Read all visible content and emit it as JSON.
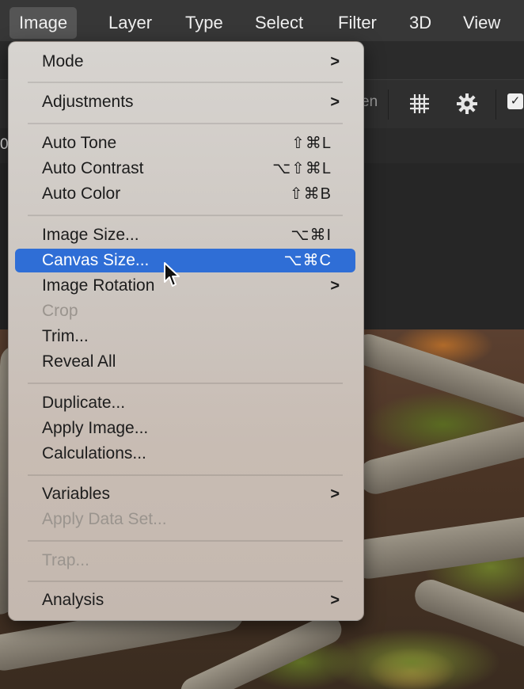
{
  "menubar": {
    "items": [
      "Image",
      "Layer",
      "Type",
      "Select",
      "Filter",
      "3D",
      "View"
    ]
  },
  "toolbar": {
    "partial_label_left": "0",
    "partial_label_en": "en",
    "grid_icon": "grid-icon",
    "gear_icon": "gear-icon",
    "check_icon": "check-icon"
  },
  "menu": {
    "items": [
      {
        "label": "Mode",
        "submenu": ">"
      },
      {
        "label": "Adjustments",
        "submenu": ">"
      },
      {
        "label": "Auto Tone",
        "shortcut": "⇧⌘L"
      },
      {
        "label": "Auto Contrast",
        "shortcut": "⌥⇧⌘L"
      },
      {
        "label": "Auto Color",
        "shortcut": "⇧⌘B"
      },
      {
        "label": "Image Size...",
        "shortcut": "⌥⌘I"
      },
      {
        "label": "Canvas Size...",
        "shortcut": "⌥⌘C"
      },
      {
        "label": "Image Rotation",
        "submenu": ">"
      },
      {
        "label": "Crop"
      },
      {
        "label": "Trim..."
      },
      {
        "label": "Reveal All"
      },
      {
        "label": "Duplicate..."
      },
      {
        "label": "Apply Image..."
      },
      {
        "label": "Calculations..."
      },
      {
        "label": "Variables",
        "submenu": ">"
      },
      {
        "label": "Apply Data Set..."
      },
      {
        "label": "Trap..."
      },
      {
        "label": "Analysis",
        "submenu": ">"
      }
    ]
  },
  "colors": {
    "menubar_bg": "#373737",
    "menu_bg": "#d7d4d0",
    "highlight": "#2f6ed6",
    "disabled_text": "#9a948e"
  }
}
